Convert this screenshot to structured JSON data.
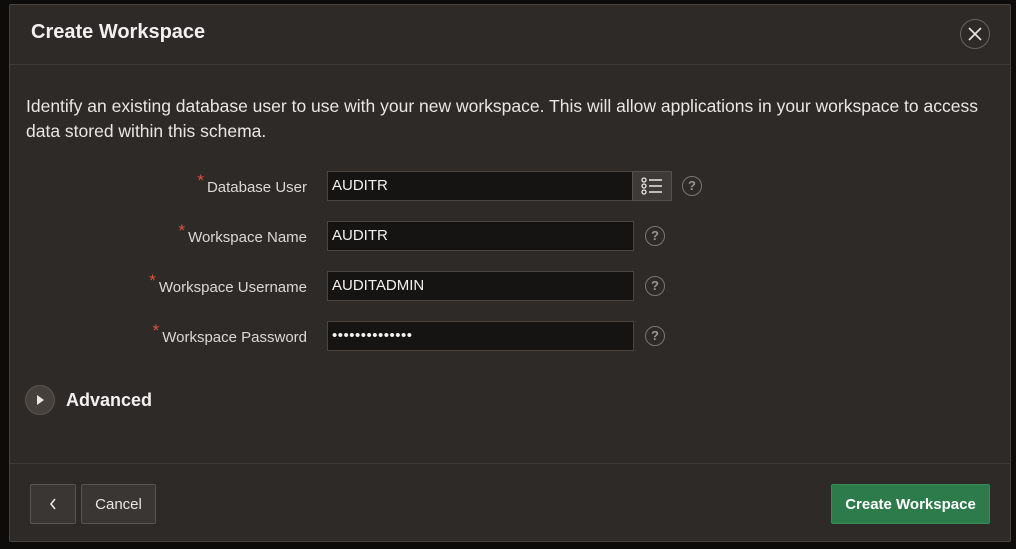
{
  "dialog": {
    "title": "Create Workspace"
  },
  "intro_text": "Identify an existing database user to use with your new workspace. This will allow applications in your workspace to access data stored within this schema.",
  "form": {
    "required_marker": "*",
    "help_glyph": "?",
    "database_user": {
      "label": "Database User",
      "value": "AUDITR"
    },
    "workspace_name": {
      "label": "Workspace Name",
      "value": "AUDITR"
    },
    "workspace_username": {
      "label": "Workspace Username",
      "value": "AUDITADMIN"
    },
    "workspace_password": {
      "label": "Workspace Password",
      "value": "••••••••••••••"
    }
  },
  "advanced": {
    "label": "Advanced"
  },
  "footer": {
    "cancel_label": "Cancel",
    "create_label": "Create Workspace"
  },
  "colors": {
    "dialog_bg": "#2e2a27",
    "field_bg": "#161412",
    "primary_button": "#2d7a4b",
    "required": "#e0503e"
  },
  "icons": {
    "close": "close-icon",
    "list_of_values": "list-icon",
    "help": "help-icon",
    "expand": "play-triangle-icon",
    "back": "chevron-left-icon"
  }
}
